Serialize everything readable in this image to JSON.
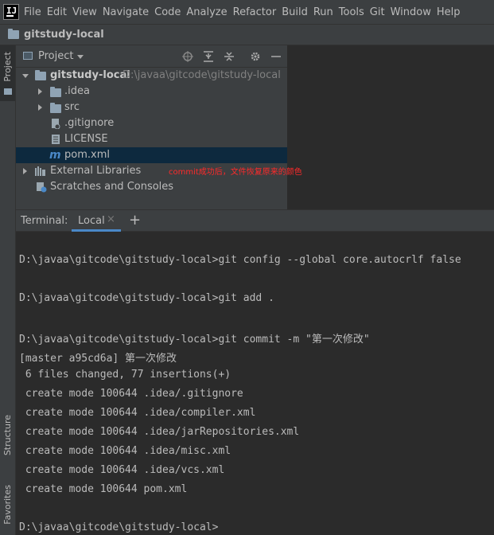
{
  "menubar": {
    "items": [
      "File",
      "Edit",
      "View",
      "Navigate",
      "Code",
      "Analyze",
      "Refactor",
      "Build",
      "Run",
      "Tools",
      "Git",
      "Window",
      "Help"
    ]
  },
  "navbar": {
    "project_name": "gitstudy-local"
  },
  "left_strip": {
    "project_label": "Project",
    "structure_label": "Structure",
    "favorites_label": "Favorites"
  },
  "project_panel": {
    "title": "Project",
    "root": {
      "name": "gitstudy-local",
      "path": "D:\\javaa\\gitcode\\gitstudy-local"
    },
    "items": [
      {
        "name": ".idea"
      },
      {
        "name": "src"
      },
      {
        "name": ".gitignore"
      },
      {
        "name": "LICENSE"
      },
      {
        "name": "pom.xml"
      },
      {
        "name": "External Libraries"
      },
      {
        "name": "Scratches and Consoles"
      }
    ]
  },
  "annotation": "commit成功后，文件恢复原来的颜色",
  "terminal": {
    "label": "Terminal:",
    "tab": "Local",
    "lines": [
      "D:\\javaa\\gitcode\\gitstudy-local>git config --global core.autocrlf false",
      "D:\\javaa\\gitcode\\gitstudy-local>git add .",
      "D:\\javaa\\gitcode\\gitstudy-local>git commit -m \"第一次修改\"",
      "[master a95cd6a] 第一次修改",
      " 6 files changed, 77 insertions(+)",
      " create mode 100644 .idea/.gitignore",
      " create mode 100644 .idea/compiler.xml",
      " create mode 100644 .idea/jarRepositories.xml",
      " create mode 100644 .idea/misc.xml",
      " create mode 100644 .idea/vcs.xml",
      " create mode 100644 pom.xml",
      "D:\\javaa\\gitcode\\gitstudy-local>"
    ]
  },
  "colors": {
    "accent": "#4a88c7",
    "annotation": "#ff2a2a",
    "selection": "#0d293e"
  }
}
